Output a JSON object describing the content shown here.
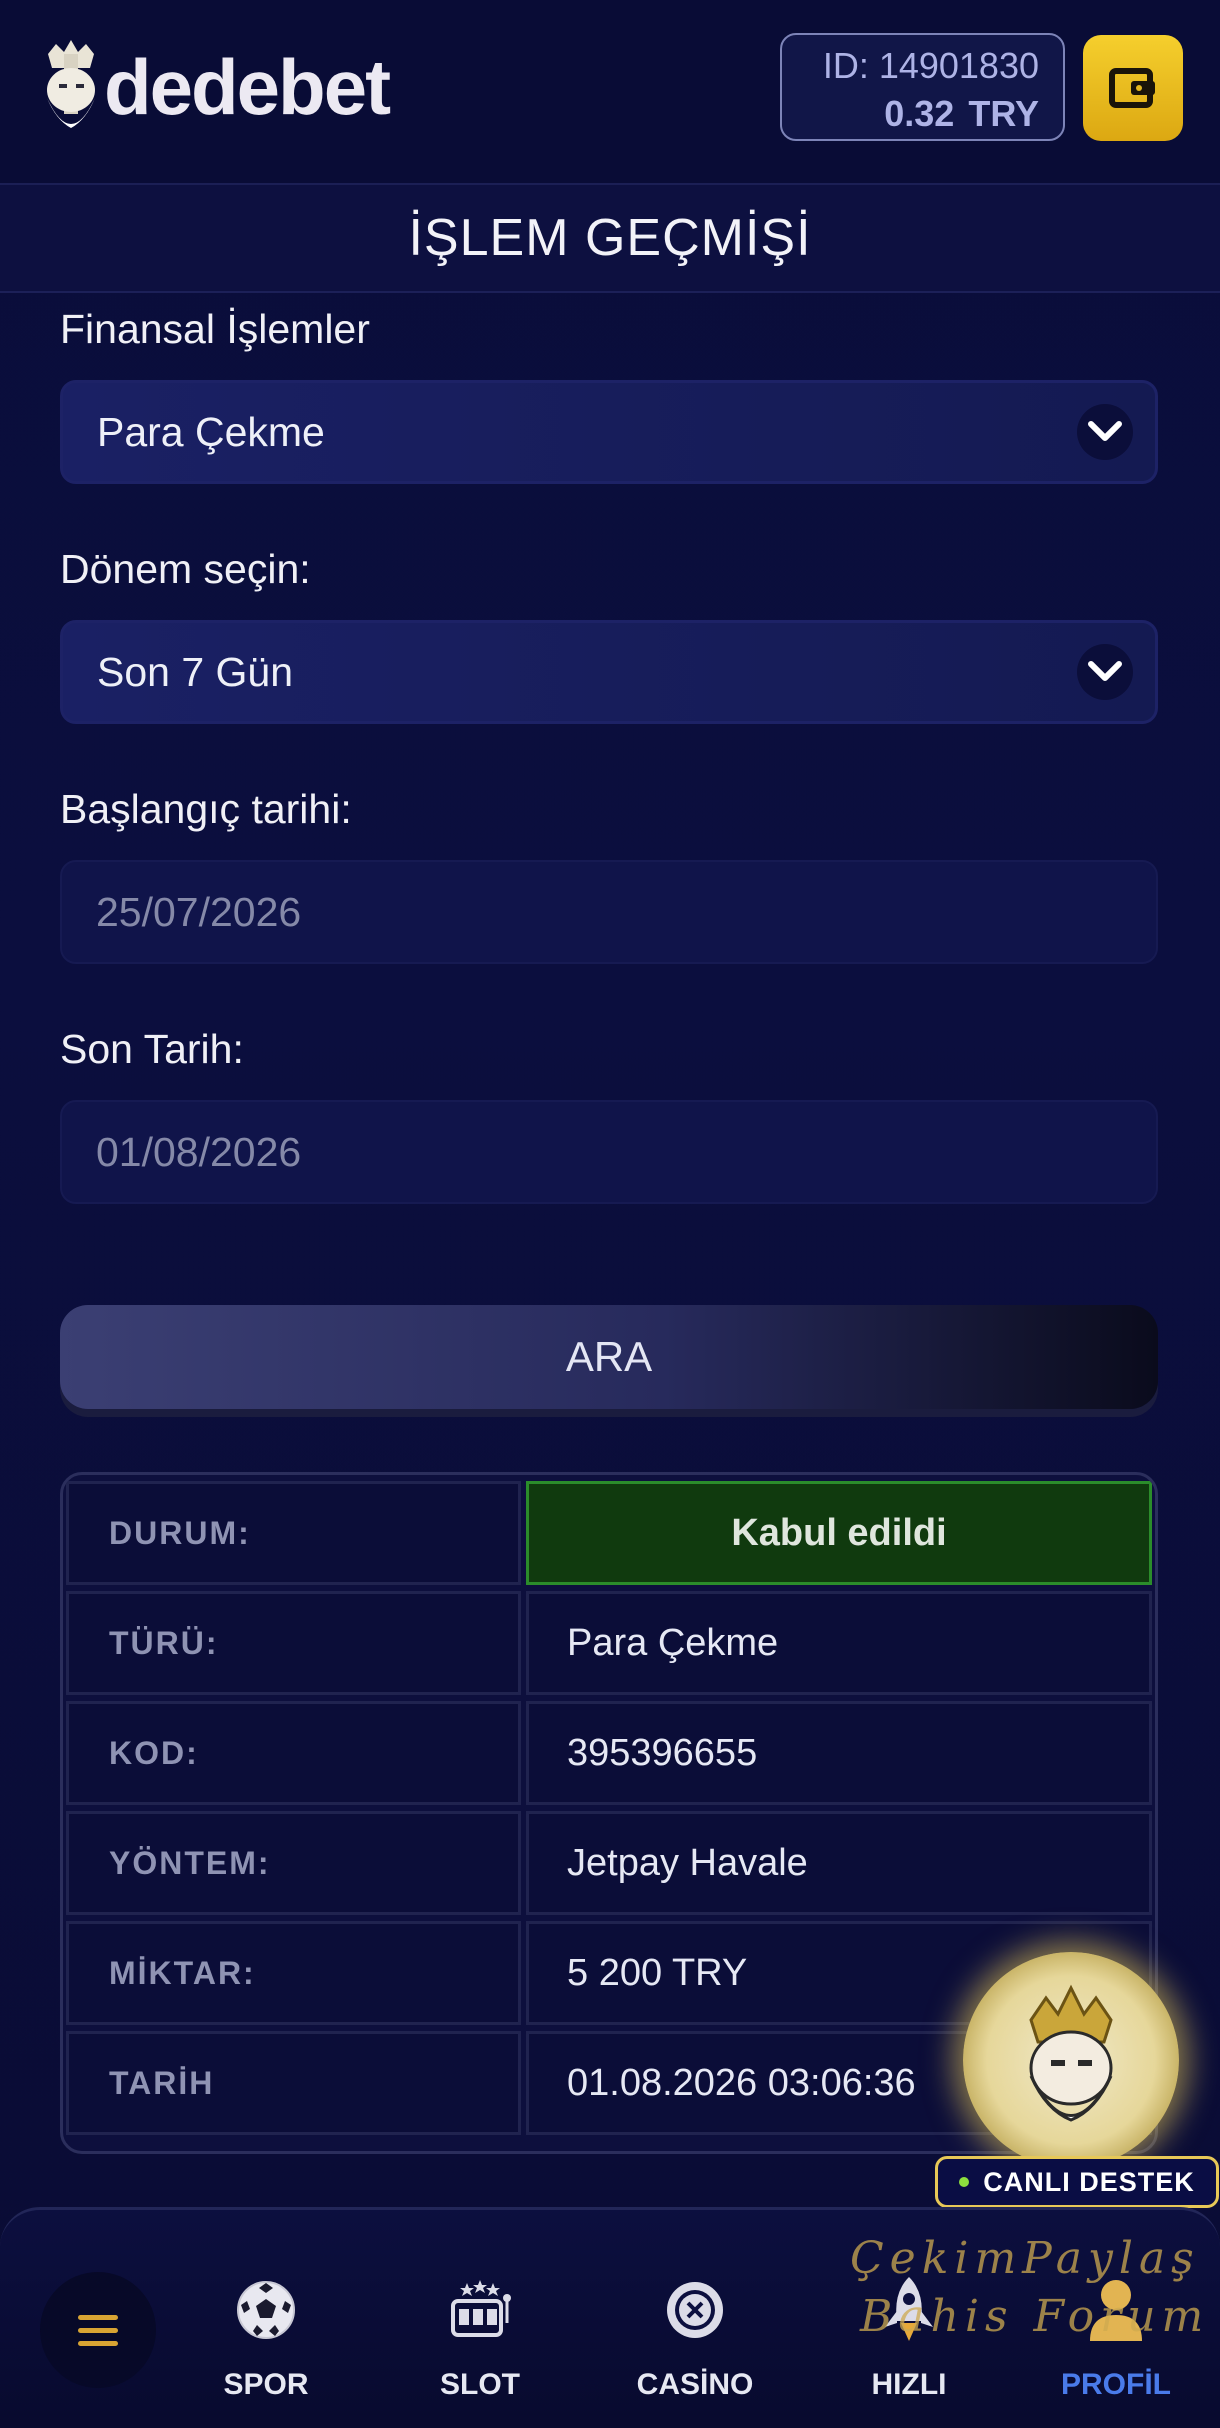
{
  "header": {
    "logo_text": "dedebet",
    "user_id": "ID: 14901830",
    "balance": "0.32",
    "currency": "TRY"
  },
  "page": {
    "title": "İŞLEM GEÇMİŞİ"
  },
  "form": {
    "category_label": "Finansal İşlemler",
    "category_value": "Para Çekme",
    "period_label": "Dönem seçin:",
    "period_value": "Son 7 Gün",
    "start_label": "Başlangıç tarihi:",
    "start_value": "25/07/2026",
    "end_label": "Son Tarih:",
    "end_value": "01/08/2026",
    "search_label": "ARA"
  },
  "transaction": {
    "rows": [
      {
        "key": "DURUM:",
        "value": "Kabul edildi"
      },
      {
        "key": "TÜRÜ:",
        "value": "Para Çekme"
      },
      {
        "key": "KOD:",
        "value": "395396655"
      },
      {
        "key": "YÖNTEM:",
        "value": "Jetpay Havale"
      },
      {
        "key": "MİKTAR:",
        "value": "5 200 TRY"
      },
      {
        "key": "TARİH",
        "value": "01.08.2026 03:06:36"
      }
    ]
  },
  "support": {
    "label": "CANLI DESTEK"
  },
  "nav": {
    "items": [
      {
        "label": "SPOR",
        "icon": "soccer-ball-icon"
      },
      {
        "label": "SLOT",
        "icon": "slot-machine-icon"
      },
      {
        "label": "CASİNO",
        "icon": "roulette-chip-icon"
      },
      {
        "label": "HIZLI",
        "icon": "rocket-icon"
      },
      {
        "label": "PROFİL",
        "icon": "user-icon"
      }
    ]
  },
  "watermark": {
    "line1": "ÇekimPaylaş",
    "line2": "Bahis Forum"
  },
  "colors": {
    "accent_gold": "#f5cf2d",
    "status_ok": "#103a0e",
    "active_nav": "#4a7bea"
  }
}
